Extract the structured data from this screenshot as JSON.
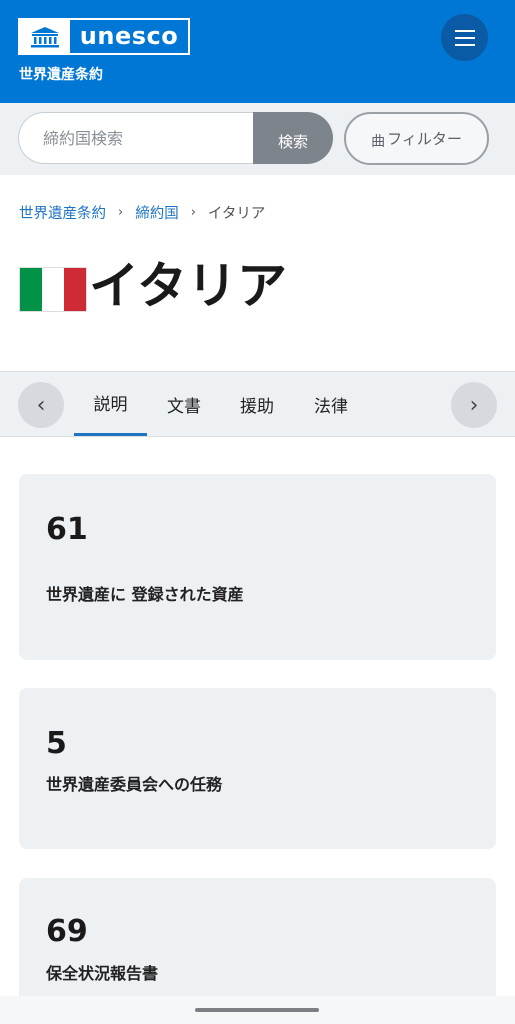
{
  "header": {
    "logo_text": "unesco",
    "subtitle": "世界遺産条約",
    "menu_icon": "hamburger-icon"
  },
  "search": {
    "placeholder": "締約国検索",
    "button_label": "検索",
    "filter_label": "フィルター",
    "filter_icon": "曲"
  },
  "breadcrumb": {
    "items": [
      "世界遺産条約",
      "締約国",
      "イタリア"
    ],
    "separator": "›"
  },
  "page": {
    "title": "イタリア",
    "flag_colors": [
      "#009246",
      "#ffffff",
      "#ce2b37"
    ]
  },
  "tabs": {
    "items": [
      "説明",
      "文書",
      "援助",
      "法律"
    ],
    "active": 0,
    "prev_icon": "‹",
    "next_icon": "›"
  },
  "stats": [
    {
      "value": "61",
      "label": "世界遺産に 登録された資産"
    },
    {
      "value": "5",
      "label": "世界遺産委員会への任務"
    },
    {
      "value": "69",
      "label": "保全状況報告書"
    }
  ],
  "colors": {
    "brand_blue": "#0077d4",
    "link_blue": "#1f73c4",
    "panel_gray": "#eef1f4"
  }
}
